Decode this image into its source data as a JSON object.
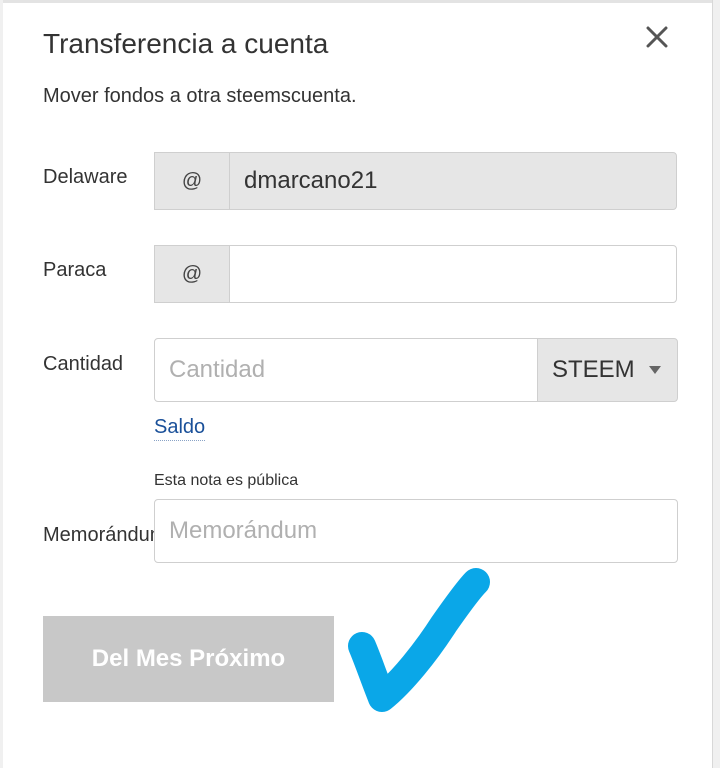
{
  "dialog": {
    "title": "Transferencia a cuenta",
    "subtitle": "Mover fondos a otra steemscuenta."
  },
  "icons": {
    "close": "close-icon",
    "dropdown": "caret-down-icon",
    "annotation": "checkmark-annotation-icon"
  },
  "form": {
    "from": {
      "label": "Delaware",
      "prefix": "@",
      "value": "dmarcano21"
    },
    "to": {
      "label": "Paraca",
      "prefix": "@",
      "value": ""
    },
    "amount": {
      "label": "Cantidad",
      "placeholder": "Cantidad",
      "currency": "STEEM",
      "balance_link": "Saldo"
    },
    "memo": {
      "note": "Esta nota es pública",
      "label": "Memorándum",
      "placeholder": "Memorándum"
    },
    "submit_label": "Del Mes Próximo"
  },
  "colors": {
    "link": "#1a5099",
    "disabled_button": "#c8c8c8",
    "annotation_check": "#0aa7e8"
  }
}
